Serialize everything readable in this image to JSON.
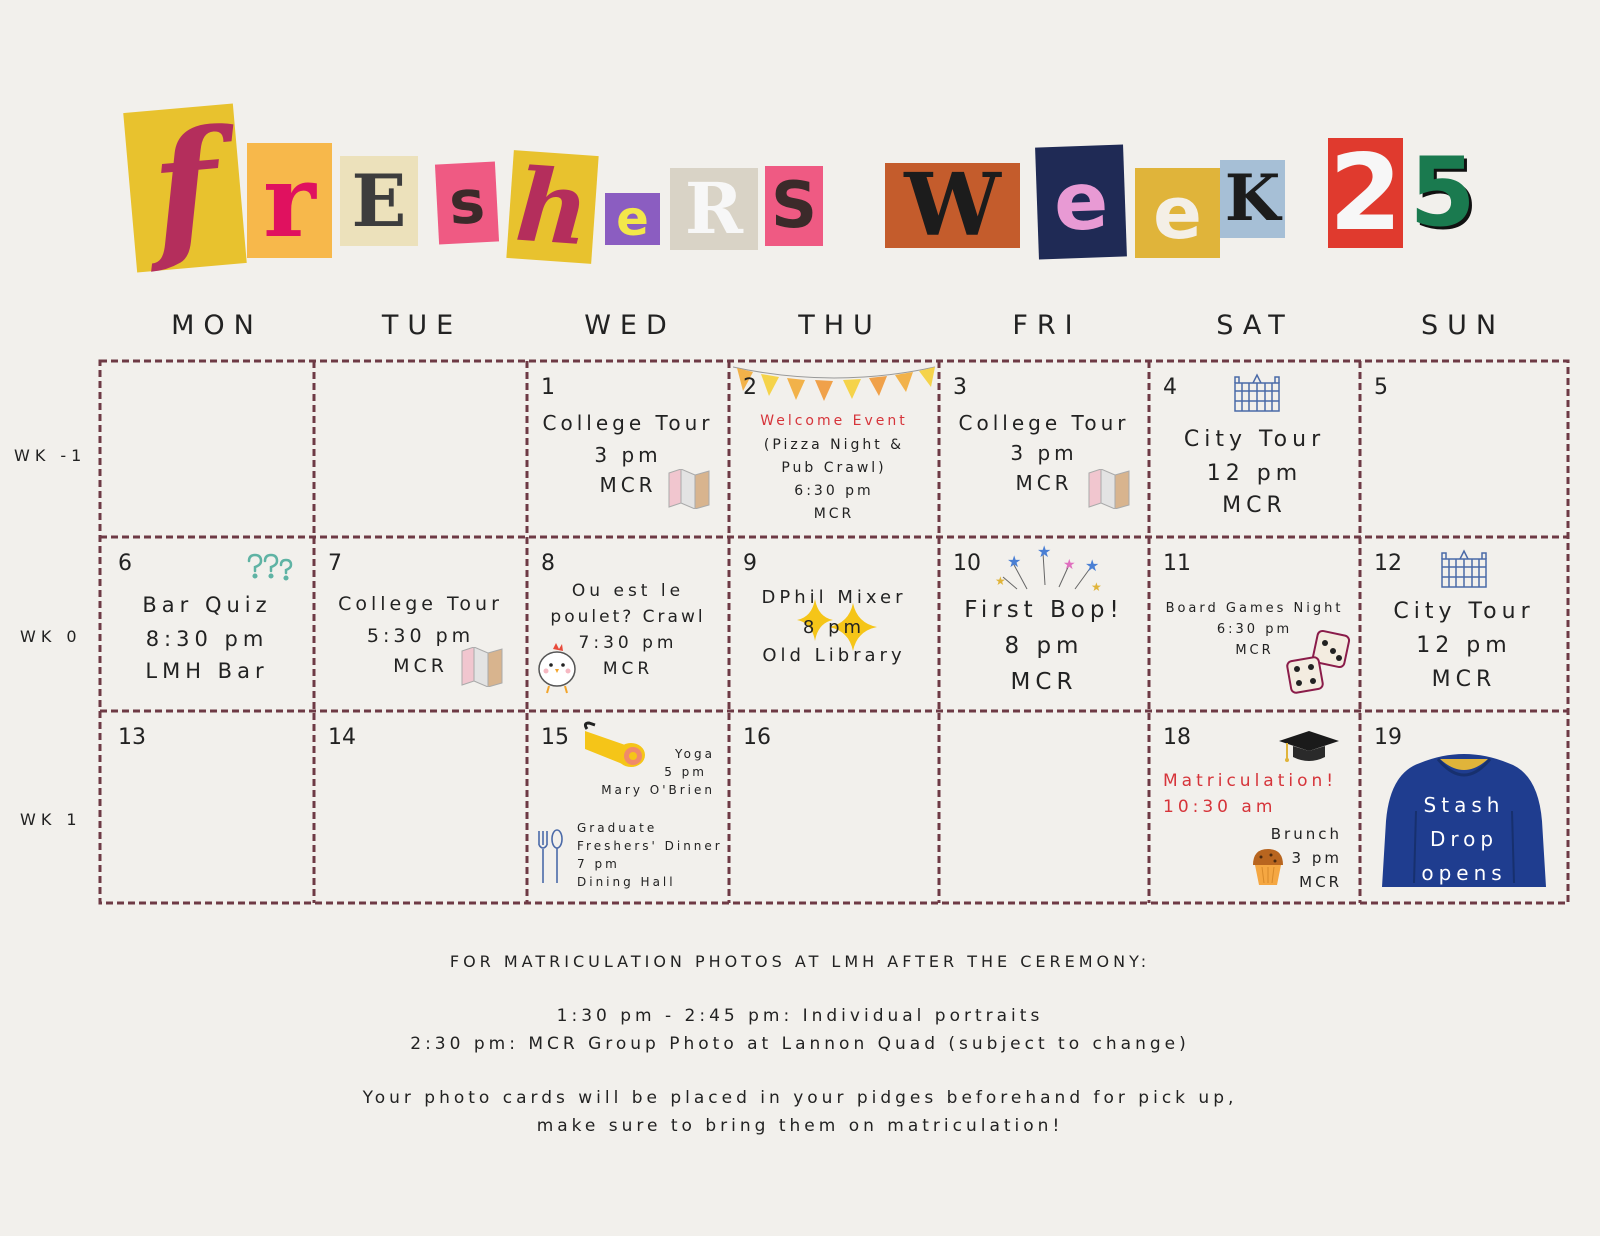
{
  "title": {
    "letters": [
      "f",
      "r",
      "E",
      "s",
      "h",
      "e",
      "R",
      "S",
      "W",
      "e",
      "e",
      "K",
      "2",
      "5"
    ]
  },
  "days": [
    "MON",
    "TUE",
    "WED",
    "THU",
    "FRI",
    "SAT",
    "SUN"
  ],
  "weeks": [
    "WK -1",
    "WK 0",
    "WK 1"
  ],
  "cells": {
    "w1wed": {
      "num": "1",
      "l1": "College Tour",
      "l2": "3 pm",
      "l3": "MCR"
    },
    "w1thu": {
      "num": "2",
      "l1": "Welcome Event",
      "l2": "(Pizza Night &",
      "l3": "Pub Crawl)",
      "l4": "6:30 pm",
      "l5": "MCR"
    },
    "w1fri": {
      "num": "3",
      "l1": "College Tour",
      "l2": "3 pm",
      "l3": "MCR"
    },
    "w1sat": {
      "num": "4",
      "l1": "City Tour",
      "l2": "12 pm",
      "l3": "MCR"
    },
    "w1sun": {
      "num": "5"
    },
    "w2mon": {
      "num": "6",
      "l1": "Bar Quiz",
      "l2": "8:30 pm",
      "l3": "LMH Bar"
    },
    "w2tue": {
      "num": "7",
      "l1": "College Tour",
      "l2": "5:30 pm",
      "l3": "MCR"
    },
    "w2wed": {
      "num": "8",
      "l1": "Ou est le",
      "l2": "poulet? Crawl",
      "l3": "7:30 pm",
      "l4": "MCR"
    },
    "w2thu": {
      "num": "9",
      "l1": "DPhil Mixer",
      "l2": "8 pm",
      "l3": "Old Library"
    },
    "w2fri": {
      "num": "10",
      "l1": "First Bop!",
      "l2": "8 pm",
      "l3": "MCR"
    },
    "w2sat": {
      "num": "11",
      "l1": "Board Games Night",
      "l2": "6:30 pm",
      "l3": "MCR"
    },
    "w2sun": {
      "num": "12",
      "l1": "City Tour",
      "l2": "12 pm",
      "l3": "MCR"
    },
    "w3mon": {
      "num": "13"
    },
    "w3tue": {
      "num": "14"
    },
    "w3wed": {
      "num": "15",
      "y1": "Yoga",
      "y2": "5 pm",
      "y3": "Mary O'Brien",
      "g1": "Graduate",
      "g2": "Freshers' Dinner",
      "g3": "7 pm",
      "g4": "Dining Hall"
    },
    "w3thu": {
      "num": "16"
    },
    "w3sat": {
      "num": "18",
      "l1": "Matriculation!",
      "l2": "10:30 am",
      "b1": "Brunch",
      "b2": "3 pm",
      "b3": "MCR"
    },
    "w3sun": {
      "num": "19",
      "l1": "Stash",
      "l2": "Drop",
      "l3": "opens"
    }
  },
  "footer": {
    "heading": "FOR MATRICULATION PHOTOS AT LMH AFTER THE CEREMONY:",
    "line1": "1:30 pm - 2:45 pm: Individual portraits",
    "line2": "2:30 pm: MCR Group Photo at Lannon Quad (subject to change)",
    "line3": "Your photo cards will be placed in your pidges beforehand for pick up,",
    "line4": "make sure to bring them on matriculation!"
  },
  "colors": {
    "grid": "#6e3a45",
    "accent_red": "#d6343a",
    "background": "#f2f0ec",
    "hoodie": "#1f3d8f"
  },
  "icons": [
    "map-icon",
    "bunting-icon",
    "building-icon",
    "question-marks-icon",
    "chicken-icon",
    "sparkle-icon",
    "stars-icon",
    "dice-icon",
    "yoga-mat-icon",
    "cutlery-icon",
    "graduation-cap-icon",
    "muffin-icon",
    "hoodie-icon"
  ]
}
